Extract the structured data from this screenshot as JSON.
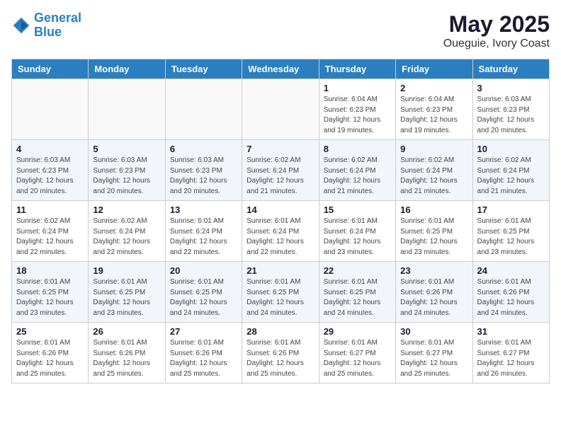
{
  "header": {
    "logo_line1": "General",
    "logo_line2": "Blue",
    "title": "May 2025",
    "subtitle": "Oueguie, Ivory Coast"
  },
  "weekdays": [
    "Sunday",
    "Monday",
    "Tuesday",
    "Wednesday",
    "Thursday",
    "Friday",
    "Saturday"
  ],
  "weeks": [
    [
      {
        "day": "",
        "info": ""
      },
      {
        "day": "",
        "info": ""
      },
      {
        "day": "",
        "info": ""
      },
      {
        "day": "",
        "info": ""
      },
      {
        "day": "1",
        "info": "Sunrise: 6:04 AM\nSunset: 6:23 PM\nDaylight: 12 hours\nand 19 minutes."
      },
      {
        "day": "2",
        "info": "Sunrise: 6:04 AM\nSunset: 6:23 PM\nDaylight: 12 hours\nand 19 minutes."
      },
      {
        "day": "3",
        "info": "Sunrise: 6:03 AM\nSunset: 6:23 PM\nDaylight: 12 hours\nand 20 minutes."
      }
    ],
    [
      {
        "day": "4",
        "info": "Sunrise: 6:03 AM\nSunset: 6:23 PM\nDaylight: 12 hours\nand 20 minutes."
      },
      {
        "day": "5",
        "info": "Sunrise: 6:03 AM\nSunset: 6:23 PM\nDaylight: 12 hours\nand 20 minutes."
      },
      {
        "day": "6",
        "info": "Sunrise: 6:03 AM\nSunset: 6:23 PM\nDaylight: 12 hours\nand 20 minutes."
      },
      {
        "day": "7",
        "info": "Sunrise: 6:02 AM\nSunset: 6:24 PM\nDaylight: 12 hours\nand 21 minutes."
      },
      {
        "day": "8",
        "info": "Sunrise: 6:02 AM\nSunset: 6:24 PM\nDaylight: 12 hours\nand 21 minutes."
      },
      {
        "day": "9",
        "info": "Sunrise: 6:02 AM\nSunset: 6:24 PM\nDaylight: 12 hours\nand 21 minutes."
      },
      {
        "day": "10",
        "info": "Sunrise: 6:02 AM\nSunset: 6:24 PM\nDaylight: 12 hours\nand 21 minutes."
      }
    ],
    [
      {
        "day": "11",
        "info": "Sunrise: 6:02 AM\nSunset: 6:24 PM\nDaylight: 12 hours\nand 22 minutes."
      },
      {
        "day": "12",
        "info": "Sunrise: 6:02 AM\nSunset: 6:24 PM\nDaylight: 12 hours\nand 22 minutes."
      },
      {
        "day": "13",
        "info": "Sunrise: 6:01 AM\nSunset: 6:24 PM\nDaylight: 12 hours\nand 22 minutes."
      },
      {
        "day": "14",
        "info": "Sunrise: 6:01 AM\nSunset: 6:24 PM\nDaylight: 12 hours\nand 22 minutes."
      },
      {
        "day": "15",
        "info": "Sunrise: 6:01 AM\nSunset: 6:24 PM\nDaylight: 12 hours\nand 23 minutes."
      },
      {
        "day": "16",
        "info": "Sunrise: 6:01 AM\nSunset: 6:25 PM\nDaylight: 12 hours\nand 23 minutes."
      },
      {
        "day": "17",
        "info": "Sunrise: 6:01 AM\nSunset: 6:25 PM\nDaylight: 12 hours\nand 23 minutes."
      }
    ],
    [
      {
        "day": "18",
        "info": "Sunrise: 6:01 AM\nSunset: 6:25 PM\nDaylight: 12 hours\nand 23 minutes."
      },
      {
        "day": "19",
        "info": "Sunrise: 6:01 AM\nSunset: 6:25 PM\nDaylight: 12 hours\nand 23 minutes."
      },
      {
        "day": "20",
        "info": "Sunrise: 6:01 AM\nSunset: 6:25 PM\nDaylight: 12 hours\nand 24 minutes."
      },
      {
        "day": "21",
        "info": "Sunrise: 6:01 AM\nSunset: 6:25 PM\nDaylight: 12 hours\nand 24 minutes."
      },
      {
        "day": "22",
        "info": "Sunrise: 6:01 AM\nSunset: 6:25 PM\nDaylight: 12 hours\nand 24 minutes."
      },
      {
        "day": "23",
        "info": "Sunrise: 6:01 AM\nSunset: 6:26 PM\nDaylight: 12 hours\nand 24 minutes."
      },
      {
        "day": "24",
        "info": "Sunrise: 6:01 AM\nSunset: 6:26 PM\nDaylight: 12 hours\nand 24 minutes."
      }
    ],
    [
      {
        "day": "25",
        "info": "Sunrise: 6:01 AM\nSunset: 6:26 PM\nDaylight: 12 hours\nand 25 minutes."
      },
      {
        "day": "26",
        "info": "Sunrise: 6:01 AM\nSunset: 6:26 PM\nDaylight: 12 hours\nand 25 minutes."
      },
      {
        "day": "27",
        "info": "Sunrise: 6:01 AM\nSunset: 6:26 PM\nDaylight: 12 hours\nand 25 minutes."
      },
      {
        "day": "28",
        "info": "Sunrise: 6:01 AM\nSunset: 6:26 PM\nDaylight: 12 hours\nand 25 minutes."
      },
      {
        "day": "29",
        "info": "Sunrise: 6:01 AM\nSunset: 6:27 PM\nDaylight: 12 hours\nand 25 minutes."
      },
      {
        "day": "30",
        "info": "Sunrise: 6:01 AM\nSunset: 6:27 PM\nDaylight: 12 hours\nand 25 minutes."
      },
      {
        "day": "31",
        "info": "Sunrise: 6:01 AM\nSunset: 6:27 PM\nDaylight: 12 hours\nand 26 minutes."
      }
    ]
  ]
}
